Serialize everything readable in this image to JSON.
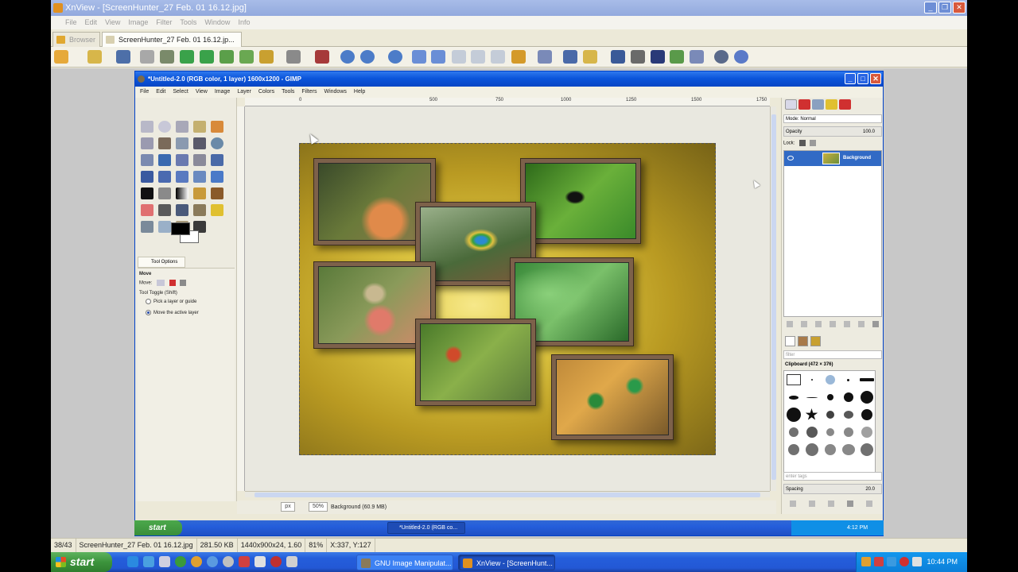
{
  "xnview": {
    "title": "XnView - [ScreenHunter_27 Feb. 01 16.12.jpg]",
    "menu": [
      "File",
      "Edit",
      "View",
      "Image",
      "Filter",
      "Tools",
      "Window",
      "Info"
    ],
    "tabs": [
      {
        "label": "Browser",
        "active": false
      },
      {
        "label": "ScreenHunter_27 Feb. 01 16.12.jp...",
        "active": true
      }
    ],
    "status": {
      "index": "38/43",
      "filename": "ScreenHunter_27 Feb. 01 16.12.jpg",
      "filesize": "281.50 KB",
      "dimensions": "1440x900x24, 1.60",
      "zoom": "81%",
      "coords": "X:337, Y:127"
    }
  },
  "gimp": {
    "title": "*Untitled-2.0 (RGB color, 1 layer) 1600x1200 - GIMP",
    "menu": [
      "File",
      "Edit",
      "Select",
      "View",
      "Image",
      "Layer",
      "Colors",
      "Tools",
      "Filters",
      "Windows",
      "Help"
    ],
    "ruler_labels": [
      "0",
      "500",
      "750",
      "1000",
      "1250",
      "1500",
      "1750"
    ],
    "tool_options": {
      "tab_label": "Tool Options",
      "tool_name": "Move",
      "move_label": "Move:",
      "toggle_label": "Tool Toggle  (Shift)",
      "option_1": "Pick a layer or guide",
      "option_2": "Move the active layer",
      "selected_option": 2
    },
    "status": {
      "unit": "px",
      "zoom": "50%",
      "layer_info": "Background (60.9 MB)"
    },
    "layers": {
      "mode_label": "Mode:  Normal",
      "opacity_label": "Opacity",
      "opacity_value": "100.0",
      "lock_label": "Lock:",
      "layer_name": "Background"
    },
    "brushes": {
      "filter_placeholder": "filter",
      "label": "Clipboard (472 × 376)",
      "tags_placeholder": "enter tags",
      "spacing_label": "Spacing",
      "spacing_value": "20.0"
    }
  },
  "inner_taskbar": {
    "start_label": "start",
    "task_label": "*Untitled-2.0 (RGB co...",
    "clock": "4:12 PM"
  },
  "taskbar": {
    "start_label": "start",
    "tasks": [
      "GNU Image Manipulat...",
      "XnView - [ScreenHunt..."
    ],
    "clock": "10:44 PM"
  },
  "colors": {
    "xp_blue": "#245edb",
    "xp_green": "#3c943c",
    "gold_center": "#f6e88a",
    "gold_edge": "#776317",
    "selection": "#316ac5"
  }
}
